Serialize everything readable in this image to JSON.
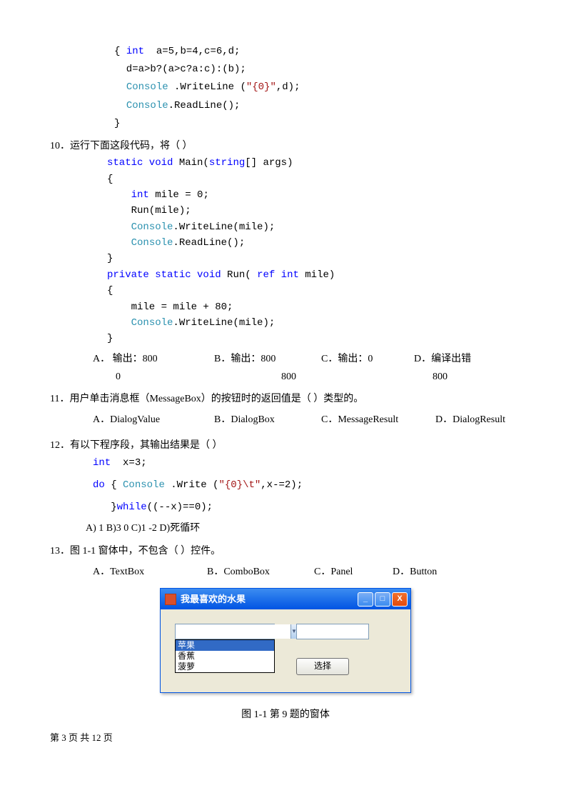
{
  "code9": {
    "l1a": "{ ",
    "l1b": "int",
    "l1c": "  a=5,b=4,c=6,d;",
    "l2": "  d=a>b?(a>c?a:c):(b);",
    "l3a": "  ",
    "l3b": "Console",
    "l3c": " .WriteLine (",
    "l3d": "\"{0}\"",
    "l3e": ",d);",
    "l4a": "  ",
    "l4b": "Console",
    "l4c": ".ReadLine();",
    "l5": "}"
  },
  "q10": {
    "text": "10．运行下面这段代码，将（      ）",
    "c1a": "static void",
    "c1b": " Main(",
    "c1c": "string",
    "c1d": "[] args)",
    "c2": "{",
    "c3a": "    ",
    "c3b": "int",
    "c3c": " mile = 0;",
    "c4": "    Run(mile);",
    "c5a": "    ",
    "c5b": "Console",
    "c5c": ".WriteLine(mile);",
    "c6a": "    ",
    "c6b": "Console",
    "c6c": ".ReadLine();",
    "c7": "}",
    "c8a": "private static void",
    "c8b": " Run( ",
    "c8c": "ref int",
    "c8d": " mile)",
    "c9": "{",
    "c10": "    mile = mile + 80;",
    "c11a": "    ",
    "c11b": "Console",
    "c11c": ".WriteLine(mile);",
    "c12": "}",
    "optA1": "A． 输出：800",
    "optA2": "0",
    "optB1": "B．输出：800",
    "optB2": "800",
    "optC1": "C．输出：0",
    "optC2": "800",
    "optD1": "D．编译出错"
  },
  "q11": {
    "text": "11．用户单击消息框（MessageBox）的按钮时的返回值是（      ）类型的。",
    "optA": "A．DialogValue",
    "optB": "B．DialogBox",
    "optC": "C．MessageResult",
    "optD": "D．DialogResult"
  },
  "q12": {
    "text": "12．有以下程序段，其输出结果是（    ）",
    "l1a": "int",
    "l1b": "  x=3;",
    "l2a": "do",
    "l2b": " { ",
    "l2c": "Console",
    "l2d": " .Write (",
    "l2e": "\"{0}\\t\"",
    "l2f": ",x-=2);",
    "l3a": "   }",
    "l3b": "while",
    "l3c": "((--x)==0);",
    "opts": "A)  1     B)3   0    C)1  -2   D)死循环"
  },
  "q13": {
    "text": "13．图 1-1 窗体中，不包含（       ）控件。",
    "optA": "A．TextBox",
    "optB": "B．ComboBox",
    "optC": "C．Panel",
    "optD": "D．Button"
  },
  "win": {
    "title": "我最喜欢的水果",
    "min": "_",
    "max": "□",
    "close": "X",
    "combo_value": "",
    "arrow": "▼",
    "items": [
      "苹果",
      "香蕉",
      "菠萝"
    ],
    "button": "选择"
  },
  "caption": "图 1-1  第 9 题的窗体",
  "footer": "第 3 页 共 12 页"
}
